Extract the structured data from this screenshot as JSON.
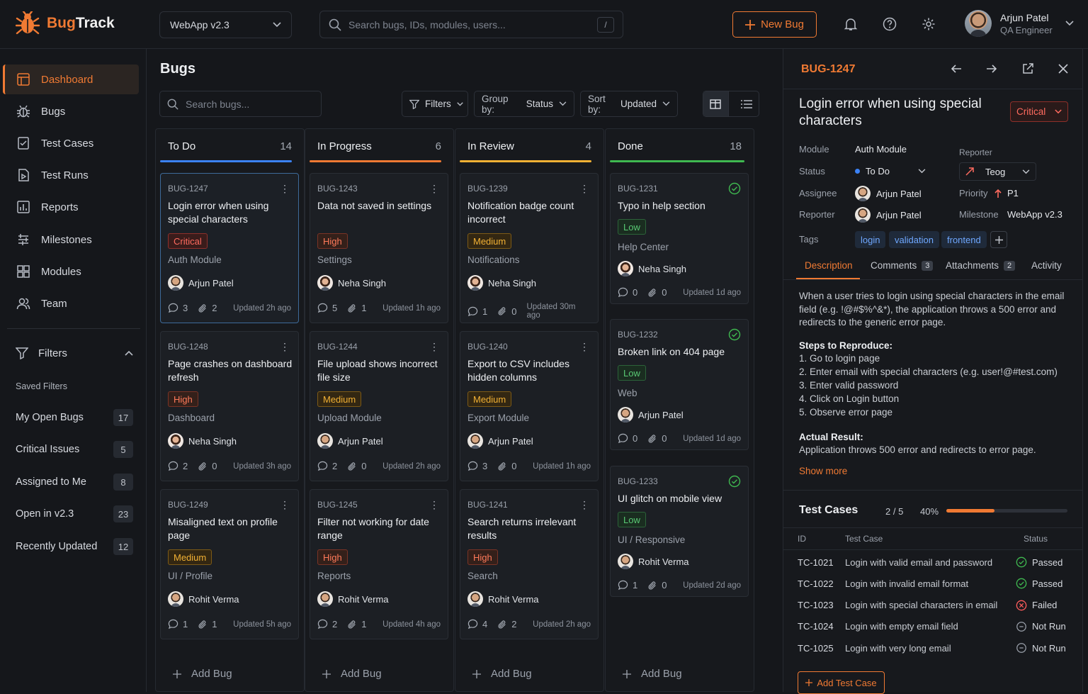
{
  "brand": {
    "name_a": "Bug",
    "name_b": "Track"
  },
  "project": {
    "name": "WebApp v2.3"
  },
  "global_search": {
    "placeholder": "Search bugs, IDs, modules, users...",
    "shortcut": "/"
  },
  "header": {
    "new_bug": "New Bug",
    "user_name": "Arjun Patel",
    "user_role": "QA Engineer"
  },
  "sidebar": {
    "items": [
      {
        "label": "Dashboard",
        "icon": "dashboard-icon"
      },
      {
        "label": "Bugs",
        "icon": "bug-icon"
      },
      {
        "label": "Test Cases",
        "icon": "test-cases-icon"
      },
      {
        "label": "Test Runs",
        "icon": "test-runs-icon"
      },
      {
        "label": "Reports",
        "icon": "reports-icon"
      },
      {
        "label": "Milestones",
        "icon": "milestones-icon"
      },
      {
        "label": "Modules",
        "icon": "modules-icon"
      },
      {
        "label": "Team",
        "icon": "team-icon"
      }
    ],
    "filters_label": "Filters",
    "saved_label": "Saved Filters",
    "saved": [
      {
        "label": "My Open Bugs",
        "count": "17"
      },
      {
        "label": "Critical Issues",
        "count": "5"
      },
      {
        "label": "Assigned to Me",
        "count": "8"
      },
      {
        "label": "Open in v2.3",
        "count": "23"
      },
      {
        "label": "Recently Updated",
        "count": "12"
      }
    ]
  },
  "main": {
    "title": "Bugs",
    "search_placeholder": "Search bugs...",
    "filters": "Filters",
    "group_label": "Group by:",
    "group_value": "Status",
    "sort_label": "Sort by:",
    "sort_value": "Updated",
    "add_bug": "Add Bug"
  },
  "columns": [
    {
      "title": "To Do",
      "count": "14",
      "color": "#3b82f6",
      "cards": [
        {
          "id": "BUG-1247",
          "title": "Login error when using special characters",
          "priority": "Critical",
          "module": "Auth Module",
          "user": "Arjun Patel",
          "g": "m",
          "comments": "3",
          "attach": "2",
          "updated": "Updated 2h ago"
        },
        {
          "id": "BUG-1248",
          "title": "Page crashes on dashboard refresh",
          "priority": "High",
          "module": "Dashboard",
          "user": "Neha Singh",
          "g": "f",
          "comments": "2",
          "attach": "0",
          "updated": "Updated 3h ago"
        },
        {
          "id": "BUG-1249",
          "title": "Misaligned text on profile page",
          "priority": "Medium",
          "module": "UI / Profile",
          "user": "Rohit Verma",
          "g": "m",
          "comments": "1",
          "attach": "1",
          "updated": "Updated 5h ago"
        }
      ]
    },
    {
      "title": "In Progress",
      "count": "6",
      "color": "#f07a33",
      "cards": [
        {
          "id": "BUG-1243",
          "title": "Data not saved in settings",
          "priority": "High",
          "module": "Settings",
          "user": "Neha Singh",
          "g": "f",
          "comments": "5",
          "attach": "1",
          "updated": "Updated 1h ago"
        },
        {
          "id": "BUG-1244",
          "title": "File upload shows incorrect file size",
          "priority": "Medium",
          "module": "Upload Module",
          "user": "Arjun Patel",
          "g": "m",
          "comments": "2",
          "attach": "0",
          "updated": "Updated 2h ago"
        },
        {
          "id": "BUG-1245",
          "title": "Filter not working for date range",
          "priority": "High",
          "module": "Reports",
          "user": "Rohit Verma",
          "g": "m",
          "comments": "2",
          "attach": "1",
          "updated": "Updated 4h ago"
        }
      ]
    },
    {
      "title": "In Review",
      "count": "4",
      "color": "#f2b134",
      "cards": [
        {
          "id": "BUG-1239",
          "title": "Notification badge count incorrect",
          "priority": "Medium",
          "module": "Notifications",
          "user": "Neha Singh",
          "g": "f",
          "comments": "1",
          "attach": "0",
          "updated": "Updated 30m ago"
        },
        {
          "id": "BUG-1240",
          "title": "Export to CSV includes hidden columns",
          "priority": "Medium",
          "module": "Export Module",
          "user": "Arjun Patel",
          "g": "m",
          "comments": "3",
          "attach": "0",
          "updated": "Updated 1h ago"
        },
        {
          "id": "BUG-1241",
          "title": "Search returns irrelevant results",
          "priority": "High",
          "module": "Search",
          "user": "Rohit Verma",
          "g": "m",
          "comments": "4",
          "attach": "2",
          "updated": "Updated 2h ago"
        }
      ]
    },
    {
      "title": "Done",
      "count": "18",
      "color": "#3fb950",
      "cards": [
        {
          "id": "BUG-1231",
          "title": "Typo in help section",
          "priority": "Low",
          "module": "Help Center",
          "user": "Neha Singh",
          "g": "f",
          "comments": "0",
          "attach": "0",
          "updated": "Updated 1d ago"
        },
        {
          "id": "BUG-1232",
          "title": "Broken link on 404 page",
          "priority": "Low",
          "module": "Web",
          "user": "Arjun Patel",
          "g": "m",
          "comments": "0",
          "attach": "0",
          "updated": "Updated 1d ago"
        },
        {
          "id": "BUG-1233",
          "title": "UI glitch on mobile view",
          "priority": "Low",
          "module": "UI / Responsive",
          "user": "Rohit Verma",
          "g": "m",
          "comments": "1",
          "attach": "0",
          "updated": "Updated 2d ago"
        }
      ]
    }
  ],
  "detail": {
    "id": "BUG-1247",
    "title": "Login error when using special characters",
    "severity": "Critical",
    "module_label": "Module",
    "module": "Auth Module",
    "status_label": "Status",
    "status": "To Do",
    "assignee_label": "Assignee",
    "assignee": "Arjun Patel",
    "reporter_label": "Reporter",
    "reporter": "Arjun Patel",
    "reporter2_label": "Reporter",
    "reporter2": "Teog",
    "priority_label": "Priority",
    "priority": "P1",
    "milestone_label": "Milestone",
    "milestone": "WebApp v2.3",
    "tags_label": "Tags",
    "tags": [
      "login",
      "validation",
      "frontend"
    ],
    "tabs": [
      {
        "label": "Description"
      },
      {
        "label": "Comments",
        "count": "3"
      },
      {
        "label": "Attachments",
        "count": "2"
      },
      {
        "label": "Activity"
      }
    ],
    "description": "When a user tries to login using special characters in the email field (e.g. !@#$%^&*), the application throws a 500 error and redirects to the generic error page.",
    "steps_label": "Steps to Reproduce:",
    "steps": [
      "1.  Go to login page",
      "2.  Enter email with special characters (e.g. user!@#test.com)",
      "3.  Enter valid password",
      "4.  Click on Login button",
      "5.  Observe error page"
    ],
    "actual_label": "Actual Result:",
    "actual": "Application throws 500 error and redirects to error page.",
    "show_more": "Show more",
    "tc_title": "Test Cases",
    "tc_count": "2 / 5",
    "tc_pct": "40%",
    "tc_progress": 0.4,
    "tc_headers": [
      "ID",
      "Test Case",
      "Status"
    ],
    "tc_rows": [
      {
        "id": "TC-1021",
        "name": "Login with valid email and password",
        "status": "Passed"
      },
      {
        "id": "TC-1022",
        "name": "Login with invalid email format",
        "status": "Passed"
      },
      {
        "id": "TC-1023",
        "name": "Login with special characters in email",
        "status": "Failed"
      },
      {
        "id": "TC-1024",
        "name": "Login with empty email field",
        "status": "Not Run"
      },
      {
        "id": "TC-1025",
        "name": "Login with very long email",
        "status": "Not Run"
      }
    ],
    "add_tc": "Add Test Case"
  },
  "colors": {
    "accent": "#f07a33",
    "todo": "#3b82f6",
    "progress": "#f07a33",
    "review": "#f2b134",
    "done": "#3fb950"
  }
}
